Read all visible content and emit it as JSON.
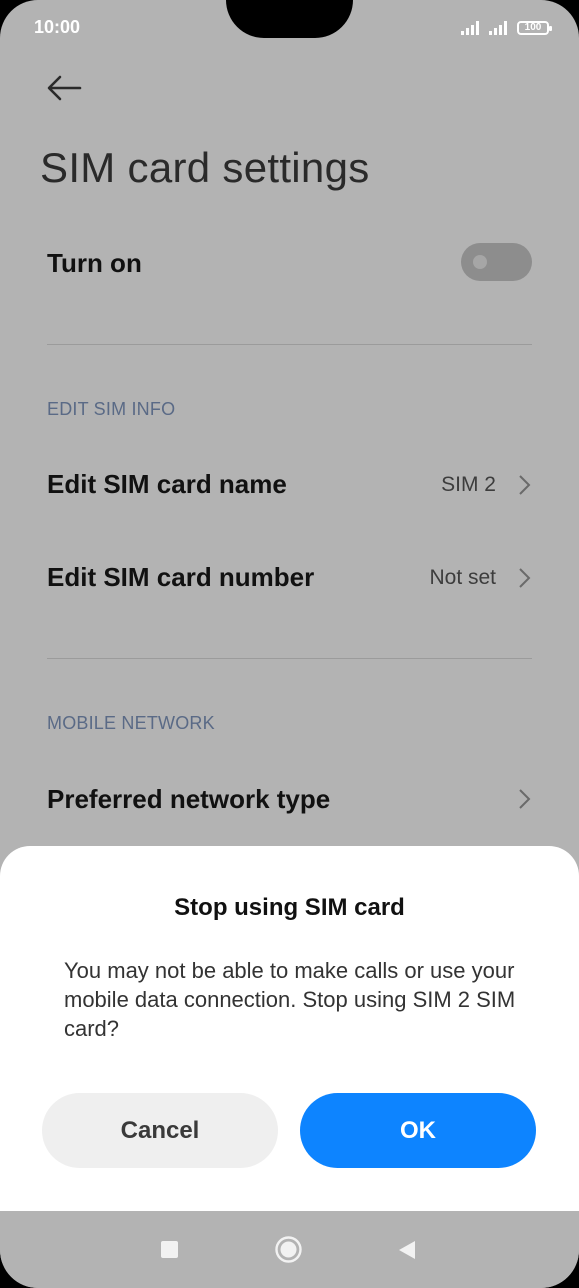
{
  "status_bar": {
    "time": "10:00",
    "battery": "100",
    "icons": [
      "signal-sim1-icon",
      "signal-sim2-icon",
      "battery-icon"
    ]
  },
  "header": {
    "back_icon": "arrow-left-icon",
    "title": "SIM card settings"
  },
  "settings": {
    "turn_on": {
      "label": "Turn on",
      "enabled": false
    },
    "edit_sim_info": {
      "section_label": "EDIT SIM INFO",
      "items": [
        {
          "label": "Edit SIM card name",
          "value": "SIM 2"
        },
        {
          "label": "Edit SIM card number",
          "value": "Not set"
        }
      ]
    },
    "mobile_network": {
      "section_label": "MOBILE NETWORK",
      "items": [
        {
          "label": "Preferred network type"
        }
      ]
    }
  },
  "dialog": {
    "title": "Stop using SIM card",
    "message": "You may not be able to make calls or use your mobile data connection. Stop using SIM 2 SIM card?",
    "cancel_label": "Cancel",
    "ok_label": "OK"
  },
  "colors": {
    "scrim_background": "#b3b3b3",
    "primary_button": "#0d84ff",
    "secondary_button": "#efefef",
    "section_label": "#5a6a86"
  },
  "nav_bar": {
    "icons": [
      "recents-square-icon",
      "home-circle-icon",
      "back-triangle-icon"
    ]
  }
}
